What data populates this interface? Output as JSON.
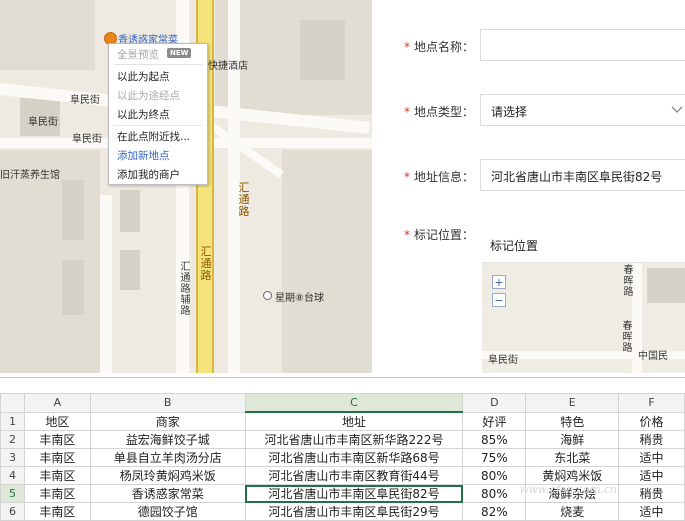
{
  "map": {
    "poi_label": "香诱惑家常菜",
    "context_menu": [
      {
        "label": "全景预览",
        "state": "disabled",
        "badge": "NEW"
      },
      {
        "label": "以此为起点",
        "state": "normal"
      },
      {
        "label": "以此为途经点",
        "state": "disabled"
      },
      {
        "label": "以此为终点",
        "state": "normal"
      },
      {
        "label": "在此点附近找...",
        "state": "normal"
      },
      {
        "label": "添加新地点",
        "state": "link"
      },
      {
        "label": "添加我的商户",
        "state": "normal"
      }
    ],
    "street_labels": {
      "kuaijie": "快捷酒店",
      "fumin1": "阜民街",
      "fumin2": "阜民街",
      "fumin3": "阜民街",
      "yangrou": "旧汗蒸养生馆",
      "huitong_road1": "汇通路",
      "huitong_road2": "汇通路",
      "huitong_aux": "汇通路辅路",
      "xingqi": "星期⑧台球"
    }
  },
  "form": {
    "name_label": "地点名称：",
    "type_label": "地点类型：",
    "type_value": "请选择",
    "address_label": "地址信息：",
    "address_value": "河北省唐山市丰南区阜民街82号",
    "mark_label": "标记位置：",
    "mark_value": "标记位置",
    "minimap": {
      "label_chunhui1": "春晖路",
      "label_chunhui2": "春晖路",
      "label_fumin": "阜民街",
      "label_bank": "中国民"
    }
  },
  "sheet": {
    "col_headers": [
      "A",
      "B",
      "C",
      "D",
      "E",
      "F"
    ],
    "rows": [
      {
        "num": "1",
        "cells": [
          "地区",
          "商家",
          "地址",
          "好评",
          "特色",
          "价格"
        ]
      },
      {
        "num": "2",
        "cells": [
          "丰南区",
          "益宏海鲜饺子城",
          "河北省唐山市丰南区新华路222号",
          "85%",
          "海鲜",
          "稍贵"
        ]
      },
      {
        "num": "3",
        "cells": [
          "丰南区",
          "单县自立羊肉汤分店",
          "河北省唐山市丰南区新华路68号",
          "75%",
          "东北菜",
          "适中"
        ]
      },
      {
        "num": "4",
        "cells": [
          "丰南区",
          "杨凤玲黄焖鸡米饭",
          "河北省唐山市丰南区教育街44号",
          "80%",
          "黄焖鸡米饭",
          "适中"
        ]
      },
      {
        "num": "5",
        "cells": [
          "丰南区",
          "香诱惑家常菜",
          "河北省唐山市丰南区阜民街82号",
          "80%",
          "海鲜杂烩",
          "稍贵"
        ]
      },
      {
        "num": "6",
        "cells": [
          "丰南区",
          "德园饺子馆",
          "河北省唐山市丰南区阜民街29号",
          "82%",
          "烧麦",
          "适中"
        ]
      }
    ],
    "watermark": "www.cfan.com.cn"
  }
}
